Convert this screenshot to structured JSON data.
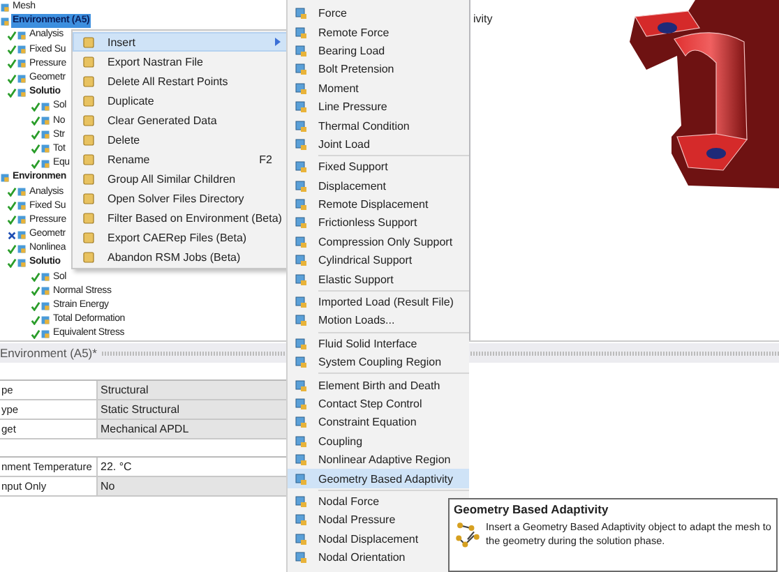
{
  "tree": {
    "items": [
      {
        "label": "Mesh",
        "bold": false,
        "selected": false
      },
      {
        "label": "Environment (A5)",
        "bold": true,
        "selected": true,
        "children": [
          {
            "label": "Analysis",
            "bold": false,
            "selected": false,
            "kind": "check"
          },
          {
            "label": "Fixed Su",
            "bold": false,
            "selected": false,
            "kind": "check"
          },
          {
            "label": "Pressure",
            "bold": false,
            "selected": false,
            "kind": "check"
          },
          {
            "label": "Geometr",
            "bold": false,
            "selected": false,
            "kind": "check"
          },
          {
            "label": "Solutio",
            "bold": true,
            "selected": false,
            "kind": "check",
            "children": [
              {
                "label": "Sol",
                "bold": false,
                "selected": false,
                "kind": "check"
              },
              {
                "label": "No",
                "bold": false,
                "selected": false,
                "kind": "check"
              },
              {
                "label": "Str",
                "bold": false,
                "selected": false,
                "kind": "check"
              },
              {
                "label": "Tot",
                "bold": false,
                "selected": false,
                "kind": "check"
              },
              {
                "label": "Equ",
                "bold": false,
                "selected": false,
                "kind": "check"
              }
            ]
          }
        ]
      },
      {
        "label": "Environmen",
        "bold": true,
        "selected": false,
        "children": [
          {
            "label": "Analysis",
            "bold": false,
            "selected": false,
            "kind": "check"
          },
          {
            "label": "Fixed Su",
            "bold": false,
            "selected": false,
            "kind": "check"
          },
          {
            "label": "Pressure",
            "bold": false,
            "selected": false,
            "kind": "check"
          },
          {
            "label": "Geometr",
            "bold": false,
            "selected": false,
            "kind": "cross"
          },
          {
            "label": "Nonlinea",
            "bold": false,
            "selected": false,
            "kind": "check"
          },
          {
            "label": "Solutio",
            "bold": true,
            "selected": false,
            "kind": "check",
            "children": [
              {
                "label": "Sol",
                "bold": false,
                "selected": false,
                "kind": "check"
              },
              {
                "label": "Normal Stress",
                "bold": false,
                "selected": false,
                "kind": "check"
              },
              {
                "label": "Strain Energy",
                "bold": false,
                "selected": false,
                "kind": "check"
              },
              {
                "label": "Total Deformation",
                "bold": false,
                "selected": false,
                "kind": "check"
              },
              {
                "label": "Equivalent Stress",
                "bold": false,
                "selected": false,
                "kind": "check"
              }
            ]
          }
        ]
      }
    ]
  },
  "viewport": {
    "title": "ivity"
  },
  "details": {
    "title": "Environment (A5)*",
    "groups": [
      {
        "rows": [
          {
            "label": "pe",
            "value": "Structural",
            "editable": false
          },
          {
            "label": "ype",
            "value": "Static Structural",
            "editable": false
          },
          {
            "label": "get",
            "value": "Mechanical APDL",
            "editable": false
          }
        ]
      },
      {
        "rows": [
          {
            "label": "nment Temperature",
            "value": "22. °C",
            "editable": true
          },
          {
            "label": "nput Only",
            "value": "No",
            "editable": false
          }
        ]
      }
    ]
  },
  "context_menu": {
    "items": [
      {
        "label": "Insert",
        "selected": true,
        "submenu": true
      },
      {
        "label": "Export Nastran File",
        "selected": false,
        "submenu": false
      },
      {
        "label": "Delete All Restart Points",
        "selected": false,
        "submenu": false
      },
      {
        "label": "Duplicate",
        "selected": false,
        "submenu": false
      },
      {
        "label": "Clear Generated Data",
        "selected": false,
        "submenu": false
      },
      {
        "label": "Delete",
        "selected": false,
        "submenu": false
      },
      {
        "label": "Rename",
        "shortcut": "F2",
        "selected": false,
        "submenu": false
      },
      {
        "label": "Group All Similar Children",
        "selected": false,
        "submenu": false
      },
      {
        "label": "Open Solver Files Directory",
        "selected": false,
        "submenu": false
      },
      {
        "label": "Filter Based on Environment (Beta)",
        "selected": false,
        "submenu": false
      },
      {
        "label": "Export CAERep Files (Beta)",
        "selected": false,
        "submenu": false
      },
      {
        "label": "Abandon RSM Jobs (Beta)",
        "selected": false,
        "submenu": false
      }
    ]
  },
  "submenu": {
    "groups": [
      {
        "items": [
          {
            "label": "Force",
            "selected": false
          },
          {
            "label": "Remote Force",
            "selected": false
          },
          {
            "label": "Bearing Load",
            "selected": false
          },
          {
            "label": "Bolt Pretension",
            "selected": false
          },
          {
            "label": "Moment",
            "selected": false
          },
          {
            "label": "Line Pressure",
            "selected": false
          },
          {
            "label": "Thermal Condition",
            "selected": false
          },
          {
            "label": "Joint Load",
            "selected": false
          }
        ]
      },
      {
        "items": [
          {
            "label": "Fixed Support",
            "selected": false
          },
          {
            "label": "Displacement",
            "selected": false
          },
          {
            "label": "Remote Displacement",
            "selected": false
          },
          {
            "label": "Frictionless Support",
            "selected": false
          },
          {
            "label": "Compression Only Support",
            "selected": false
          },
          {
            "label": "Cylindrical Support",
            "selected": false
          },
          {
            "label": "Elastic Support",
            "selected": false
          }
        ]
      },
      {
        "items": [
          {
            "label": "Imported Load (Result File)",
            "selected": false
          },
          {
            "label": "Motion Loads...",
            "selected": false
          }
        ]
      },
      {
        "items": [
          {
            "label": "Fluid Solid Interface",
            "selected": false
          },
          {
            "label": "System Coupling Region",
            "selected": false
          }
        ]
      },
      {
        "items": [
          {
            "label": "Element Birth and Death",
            "selected": false
          },
          {
            "label": "Contact Step Control",
            "selected": false
          },
          {
            "label": "Constraint Equation",
            "selected": false
          },
          {
            "label": "Coupling",
            "selected": false
          },
          {
            "label": "Nonlinear Adaptive Region",
            "selected": false
          },
          {
            "label": "Geometry Based Adaptivity",
            "selected": true
          }
        ]
      },
      {
        "items": [
          {
            "label": "Nodal Force",
            "selected": false
          },
          {
            "label": "Nodal Pressure",
            "selected": false
          },
          {
            "label": "Nodal Displacement",
            "selected": false
          },
          {
            "label": "Nodal Orientation",
            "selected": false
          }
        ]
      }
    ]
  },
  "tooltip": {
    "title": "Geometry Based Adaptivity",
    "text": "Insert a Geometry Based Adaptivity object to adapt the mesh to the geometry during the solution phase."
  }
}
